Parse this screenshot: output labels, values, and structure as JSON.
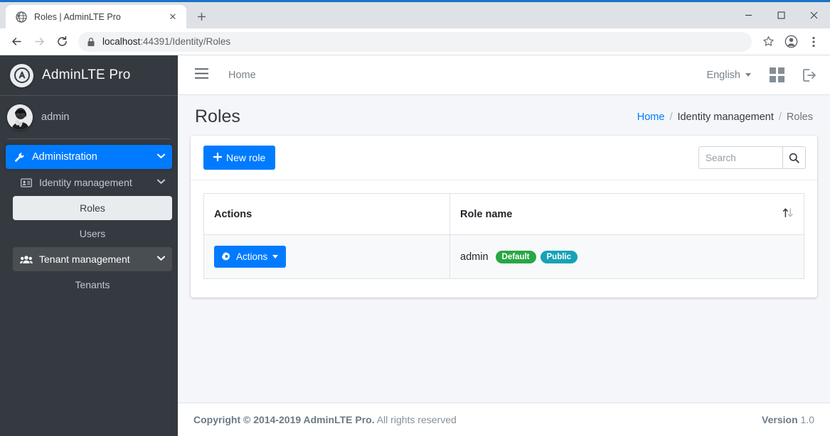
{
  "browser": {
    "tab": {
      "title": "Roles | AdminLTE Pro",
      "favicon": "globe-icon",
      "close": "✕"
    },
    "new_tab_label": "+",
    "window_controls": {
      "minimize": "–",
      "maximize": "□",
      "close": "✕"
    },
    "nav": {
      "back": "←",
      "forward": "→",
      "reload": "↻"
    },
    "address": {
      "scheme_icon": "lock-icon",
      "host": "localhost",
      "path": ":44391/Identity/Roles"
    },
    "toolbar_right": {
      "bookmark": "star-icon",
      "profile": "account-icon",
      "menu": "kebab-menu-icon"
    }
  },
  "sidebar": {
    "brand": {
      "logo": "A",
      "text": "AdminLTE Pro"
    },
    "user": {
      "name": "admin",
      "avatar": "user-avatar"
    },
    "items": [
      {
        "label": "Administration",
        "icon": "wrench-icon",
        "chevron": "⌄",
        "state": "active",
        "level": 1
      },
      {
        "label": "Identity management",
        "icon": "id-card-icon",
        "chevron": "⌄",
        "state": "open",
        "level": 2
      },
      {
        "label": "Roles",
        "icon": "",
        "chevron": "",
        "state": "sub-active",
        "level": 3
      },
      {
        "label": "Users",
        "icon": "",
        "chevron": "",
        "state": "normal",
        "level": 3
      },
      {
        "label": "Tenant management",
        "icon": "users-icon",
        "chevron": "⌄",
        "state": "hovered",
        "level": 2
      },
      {
        "label": "Tenants",
        "icon": "",
        "chevron": "",
        "state": "normal",
        "level": 3
      }
    ]
  },
  "navbar": {
    "hamburger": "hamburger-icon",
    "home_label": "Home",
    "language": "English",
    "grid_icon": "apps-grid-icon",
    "logout_icon": "sign-out-icon"
  },
  "page": {
    "title": "Roles",
    "breadcrumb": [
      {
        "label": "Home",
        "type": "link"
      },
      {
        "label": "Identity management",
        "type": "mid"
      },
      {
        "label": "Roles",
        "type": "current"
      }
    ],
    "separator": "/"
  },
  "toolbar": {
    "new_role_label": "New role",
    "new_role_icon": "plus-icon",
    "search_placeholder": "Search",
    "search_value": "",
    "search_icon": "search-icon"
  },
  "table": {
    "columns": [
      {
        "label": "Actions",
        "sortable": false
      },
      {
        "label": "Role name",
        "sortable": true,
        "sort_icon": "sort-updown-icon"
      }
    ],
    "rows": [
      {
        "action_label": "Actions",
        "action_icon": "gear-icon",
        "action_caret": "▾",
        "role_name": "admin",
        "badges": [
          {
            "label": "Default",
            "color": "#28a745"
          },
          {
            "label": "Public",
            "color": "#17a2b8"
          }
        ]
      }
    ]
  },
  "footer": {
    "copyright_bold": "Copyright © 2014-2019 AdminLTE Pro.",
    "copyright_rest": "All rights reserved",
    "version_bold": "Version",
    "version_value": "1.0"
  },
  "colors": {
    "primary": "#007bff",
    "sidebar_bg": "#343a40",
    "content_bg": "#f4f6f9",
    "success": "#28a745",
    "info": "#17a2b8"
  }
}
